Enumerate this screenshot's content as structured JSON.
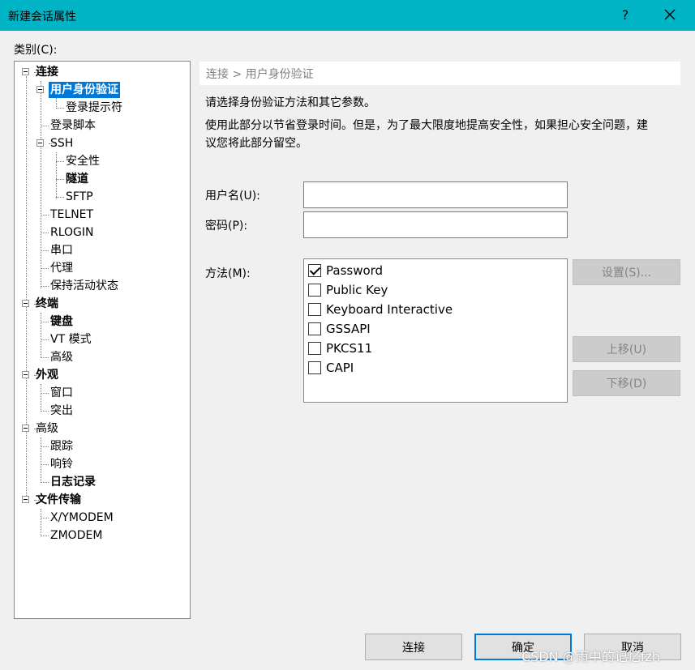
{
  "window": {
    "title": "新建会话属性",
    "help": "?"
  },
  "category_label": "类别(C):",
  "tree": {
    "items": [
      {
        "label": "连接"
      },
      {
        "label": "用户身份验证"
      },
      {
        "label": "登录提示符"
      },
      {
        "label": "登录脚本"
      },
      {
        "label": "SSH"
      },
      {
        "label": "安全性"
      },
      {
        "label": "隧道"
      },
      {
        "label": "SFTP"
      },
      {
        "label": "TELNET"
      },
      {
        "label": "RLOGIN"
      },
      {
        "label": "串口"
      },
      {
        "label": "代理"
      },
      {
        "label": "保持活动状态"
      },
      {
        "label": "终端"
      },
      {
        "label": "键盘"
      },
      {
        "label": "VT 模式"
      },
      {
        "label": "高级"
      },
      {
        "label": "外观"
      },
      {
        "label": "窗口"
      },
      {
        "label": "突出"
      },
      {
        "label": "高级"
      },
      {
        "label": "跟踪"
      },
      {
        "label": "响铃"
      },
      {
        "label": "日志记录"
      },
      {
        "label": "文件传输"
      },
      {
        "label": "X/YMODEM"
      },
      {
        "label": "ZMODEM"
      }
    ]
  },
  "panel": {
    "breadcrumb": "连接 > 用户身份验证",
    "desc1": "请选择身份验证方法和其它参数。",
    "desc2_line1": "使用此部分以节省登录时间。但是，为了最大限度地提高安全性，如果担心安全问题，建",
    "desc2_line2": "议您将此部分留空。",
    "username_label": "用户名(U):",
    "username_value": "",
    "password_label": "密码(P):",
    "password_value": "",
    "method_label": "方法(M):",
    "methods": [
      {
        "label": "Password",
        "checked": true
      },
      {
        "label": "Public Key",
        "checked": false
      },
      {
        "label": "Keyboard Interactive",
        "checked": false
      },
      {
        "label": "GSSAPI",
        "checked": false
      },
      {
        "label": "PKCS11",
        "checked": false
      },
      {
        "label": "CAPI",
        "checked": false
      }
    ],
    "settings_button": "设置(S)...",
    "move_up_button": "上移(U)",
    "move_down_button": "下移(D)"
  },
  "footer": {
    "connect": "连接",
    "ok": "确定",
    "cancel": "取消"
  },
  "watermark": "CSDN @雨中的记忆fzh",
  "colors": {
    "titlebar": "#00b4c5",
    "selection": "#0078d7"
  }
}
